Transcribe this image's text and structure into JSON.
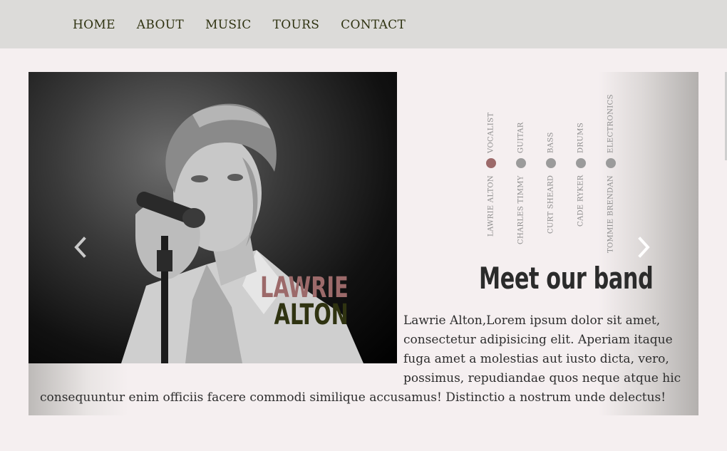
{
  "nav": {
    "items": [
      {
        "label": "HOME"
      },
      {
        "label": "ABOUT"
      },
      {
        "label": "MUSIC"
      },
      {
        "label": "TOURS"
      },
      {
        "label": "CONTACT"
      }
    ]
  },
  "slide": {
    "first_name": "LAWRIE",
    "last_name": "ALTON",
    "heading": "Meet our band",
    "description_lines": [
      "Lawrie Alton,Lorem ipsum dolor sit amet,",
      "consectetur adipisicing elit. Aperiam itaque",
      "fuga amet a molestias aut iusto dicta, vero,",
      "possimus, repudiandae quos neque atque hic",
      "consequuntur enim officiis facere commodi similique accusamus! Distinctio a nostrum unde delectus!"
    ]
  },
  "members": [
    {
      "role": "VOCALIST",
      "name": "LAWRIE ALTON",
      "active": true
    },
    {
      "role": "GUITAR",
      "name": "CHARLES TIMMY",
      "active": false
    },
    {
      "role": "BASS",
      "name": "CURT SHEARD",
      "active": false
    },
    {
      "role": "DRUMS",
      "name": "CADE RYKER",
      "active": false
    },
    {
      "role": "ELECTRONICS",
      "name": "TOMMIE BRENDAN",
      "active": false
    }
  ],
  "colors": {
    "accent": "#9c6a6a",
    "dark_olive": "#2f3311",
    "nav_bg": "#dcdbd9",
    "page_bg": "#f5eff0",
    "dot_inactive": "#9b9b9b"
  },
  "icons": {
    "prev": "chevron-left-icon",
    "next": "chevron-right-icon"
  }
}
